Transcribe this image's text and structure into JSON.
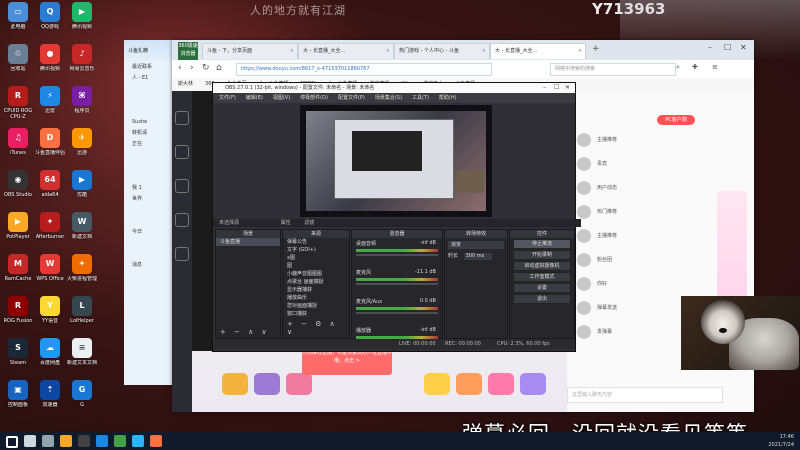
{
  "watermark": "人的地方就有江湖",
  "room_id": "Y713963",
  "subtitle": "弹幕必回，没回就没看见等等",
  "desktop_icons": [
    {
      "label": "此电脑",
      "color": "#4a8fd8",
      "glyph": "▭"
    },
    {
      "label": "QQ游戏",
      "color": "#2b7cd3",
      "glyph": "Q"
    },
    {
      "label": "腾讯视频",
      "color": "#1fb86b",
      "glyph": "▶"
    },
    {
      "label": "回收站",
      "color": "#6a7e94",
      "glyph": "♲"
    },
    {
      "label": "腾讯视频",
      "color": "#e53935",
      "glyph": "●"
    },
    {
      "label": "网易云音乐",
      "color": "#c62828",
      "glyph": "♪"
    },
    {
      "label": "CPUID ROG CPU-Z",
      "color": "#b71c1c",
      "glyph": "R"
    },
    {
      "label": "迅雷",
      "color": "#1e88e5",
      "glyph": "⚡"
    },
    {
      "label": "程序员",
      "color": "#7b1fa2",
      "glyph": "⌘"
    },
    {
      "label": "iTunes",
      "color": "#e91e63",
      "glyph": "♫"
    },
    {
      "label": "斗鱼直播伴侣",
      "color": "#ff7043",
      "glyph": "D"
    },
    {
      "label": "迅游",
      "color": "#ff9800",
      "glyph": "✈"
    },
    {
      "label": "OBS Studio",
      "color": "#333333",
      "glyph": "◉"
    },
    {
      "label": "aida64",
      "color": "#d32f2f",
      "glyph": "64"
    },
    {
      "label": "优酷",
      "color": "#1976d2",
      "glyph": "▶"
    },
    {
      "label": "PotPlayer",
      "color": "#f9a825",
      "glyph": "▶"
    },
    {
      "label": "Afterburner",
      "color": "#b71c1c",
      "glyph": "✦"
    },
    {
      "label": "新建文档",
      "color": "#455a64",
      "glyph": "W"
    },
    {
      "label": "RamCache",
      "color": "#c62828",
      "glyph": "M"
    },
    {
      "label": "WPS Office",
      "color": "#e53935",
      "glyph": "W"
    },
    {
      "label": "火柴进程管理",
      "color": "#ef6c00",
      "glyph": "✦"
    },
    {
      "label": "ROG Fusion",
      "color": "#8e0000",
      "glyph": "R"
    },
    {
      "label": "YY语音",
      "color": "#fdd835",
      "glyph": "Y"
    },
    {
      "label": "LolHelper",
      "color": "#37474f",
      "glyph": "L"
    },
    {
      "label": "Steam",
      "color": "#1b2838",
      "glyph": "S"
    },
    {
      "label": "百度网盘",
      "color": "#2196f3",
      "glyph": "☁"
    },
    {
      "label": "新建文本文档",
      "color": "#eceff1",
      "glyph": "≡"
    },
    {
      "label": "控制面板",
      "color": "#1565c0",
      "glyph": "▣"
    },
    {
      "label": "加速器",
      "color": "#0d47a1",
      "glyph": "⇡"
    },
    {
      "label": "G",
      "color": "#1976d2",
      "glyph": "G"
    }
  ],
  "chat_window": {
    "title": "斗鱼扎精",
    "rows": [
      "最近联系",
      "人 - E1",
      "",
      "",
      "",
      "Sushe",
      "转机请",
      "正在",
      "",
      "",
      "",
      "我 1",
      "世界",
      "",
      "",
      "今日",
      "",
      "",
      "消息"
    ]
  },
  "browser": {
    "logo": "360极速浏览器",
    "tabs": [
      {
        "label": "斗鱼 - 下，分享页面"
      },
      {
        "label": "大 - 长直播_大全..."
      },
      {
        "label": "热门游戏 - 个人中心 - 斗鱼"
      },
      {
        "label": "大 - 长直播_大全..."
      }
    ],
    "url": "https://www.douyu.com/8617_x-471537011880767",
    "search_placeholder": "网络中搜索的搜索",
    "bookmarks": [
      "斯大林",
      "360",
      "个人主页",
      "大一斗鱼直播",
      "MSDN",
      "大 - 斗鱼直播",
      "游戏直播",
      "Win",
      "游戏中心",
      "斗鱼直播"
    ],
    "right_panel": {
      "pc_button": "PC客户端",
      "rows": [
        "主播推荐",
        "贵宾",
        "用户动态",
        "热门推荐",
        "主播推荐",
        "粉丝团",
        "你好",
        "弹幕发送",
        "发弹幕"
      ],
      "chat_placeholder": "这里输入聊天内容"
    },
    "notice": "为你推荐直播，可能你喜欢的人在直播中哦，点击 >"
  },
  "obs": {
    "title": "OBS 27.0.1 (32-bit, windows) - 配置文件: 未命名 - 场景: 未命名",
    "menu": [
      "文件(F)",
      "编辑(E)",
      "视图(V)",
      "停靠部件(D)",
      "配置文件(P)",
      "场景集合(S)",
      "工具(T)",
      "帮助(H)"
    ],
    "scene_bar": "未选择源",
    "props_label": "属性",
    "filters_label": "滤镜",
    "scenes": {
      "title": "场景",
      "items": [
        "斗鱼直播"
      ]
    },
    "sources": {
      "title": "来源",
      "items": [
        "弹幕公告",
        "文字 (GDI+)",
        "x图",
        "图",
        "小鹿声音图图图",
        "点歌台 画面捕捉",
        "显示器捕获",
        "播放曲乐",
        "您对画面捕捉",
        "窗口捕获"
      ]
    },
    "mixer": {
      "title": "混音器",
      "channels": [
        {
          "name": "桌面音频",
          "db": "-inf dB"
        },
        {
          "name": "麦克风",
          "db": "-11.1 dB"
        },
        {
          "name": "麦克风/Aux",
          "db": "0.0 dB"
        },
        {
          "name": "播放器",
          "db": "-inf dB"
        }
      ]
    },
    "transitions": {
      "title": "转场特效",
      "type": "渐变",
      "duration_label": "时长",
      "duration_value": "300 ms"
    },
    "controls": {
      "title": "控件",
      "buttons": [
        "停止推流",
        "开始录制",
        "启动虚拟摄像机",
        "工作室模式",
        "设置",
        "退出"
      ]
    },
    "status": {
      "live": "LIVE: 00:00:00",
      "rec": "REC: 00:00:00",
      "cpu": "CPU: 2.3%, 60.00 fps",
      "bitrate": "kb/s: 0"
    }
  },
  "taskbar": {
    "time": "17:46",
    "date": "2021/7/24",
    "icons": [
      "start",
      "search",
      "task-view",
      "file-explorer",
      "obs",
      "edge",
      "chrome",
      "qq",
      "douyu"
    ]
  }
}
